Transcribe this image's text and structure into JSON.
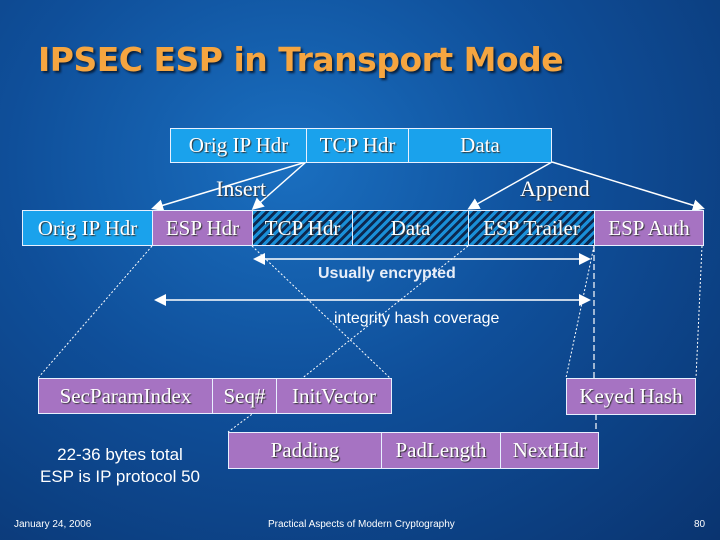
{
  "title": "IPSEC ESP in Transport Mode",
  "original_packet": [
    "Orig IP Hdr",
    "TCP Hdr",
    "Data"
  ],
  "labels": {
    "insert": "Insert",
    "append": "Append"
  },
  "esp_packet": [
    "Orig IP Hdr",
    "ESP Hdr",
    "TCP Hdr",
    "Data",
    "ESP Trailer",
    "ESP Auth"
  ],
  "ranges": {
    "encrypted": "Usually encrypted",
    "integrity": "integrity hash coverage"
  },
  "esp_header_fields": [
    "SecParamIndex",
    "Seq#",
    "InitVector"
  ],
  "esp_trailer_fields": [
    "Padding",
    "PadLength",
    "NextHdr"
  ],
  "esp_auth_fields": [
    "Keyed Hash"
  ],
  "notes": [
    "22-36 bytes total",
    "ESP is IP protocol 50"
  ],
  "footer": {
    "date": "January 24, 2006",
    "course": "Practical Aspects of Modern Cryptography",
    "page": "80"
  },
  "colors": {
    "title": "#f5a540",
    "unencrypted": "#1aa2ec",
    "esp": "#a673c2"
  }
}
